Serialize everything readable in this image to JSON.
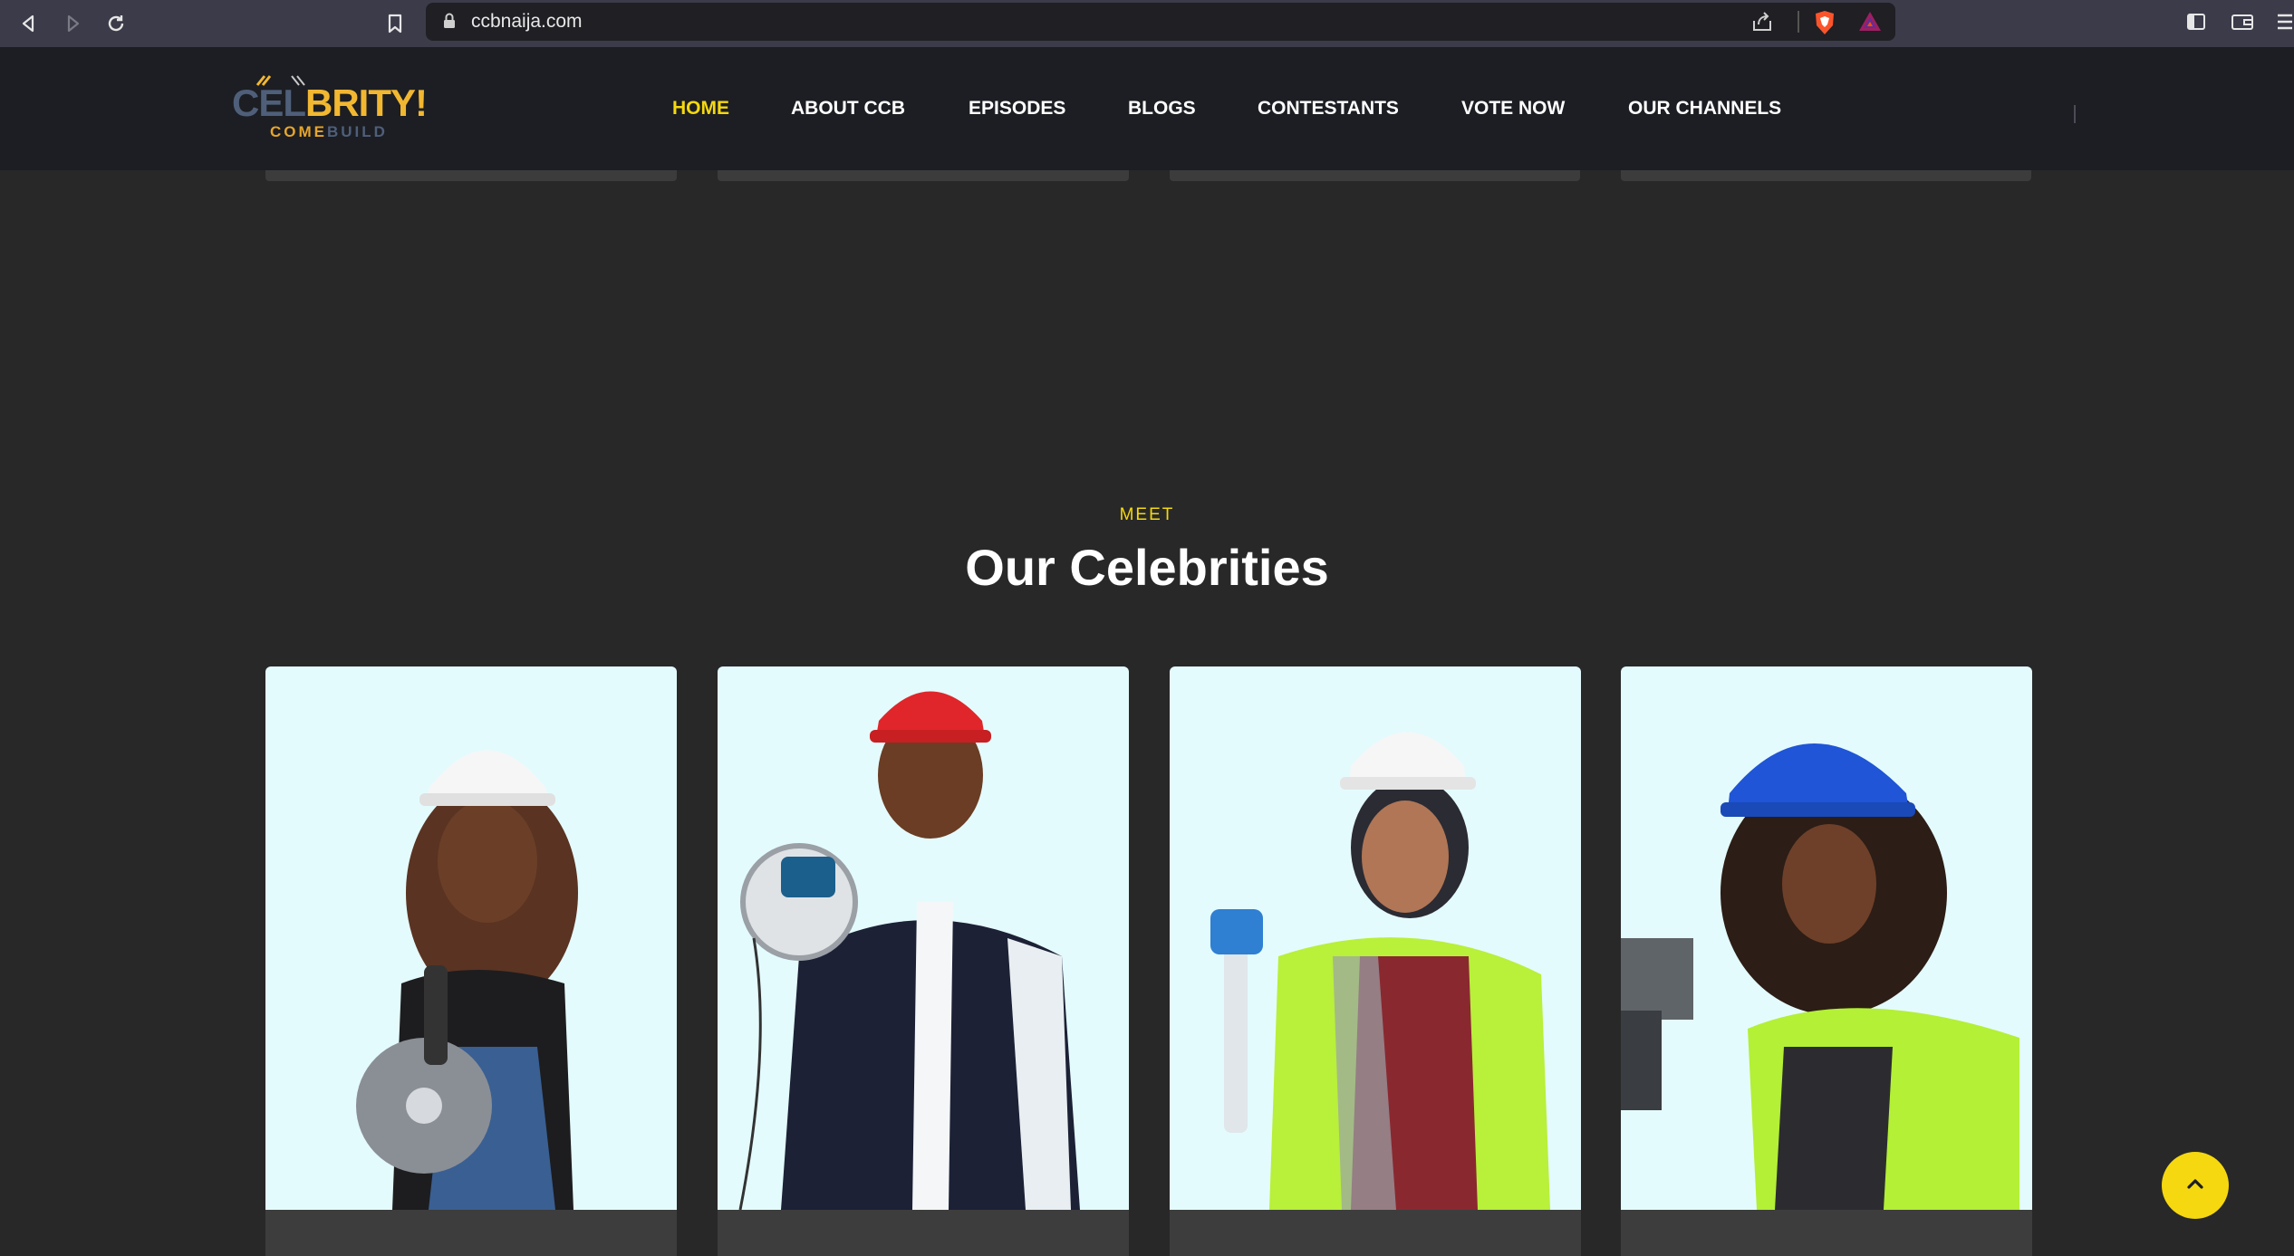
{
  "browser": {
    "url": "ccbnaija.com"
  },
  "logo": {
    "main_part1": "CEL",
    "main_part2": "BRITY!",
    "sub_part1": "COME",
    "sub_part2": "BUILD"
  },
  "nav": {
    "items": [
      {
        "label": "HOME",
        "active": true
      },
      {
        "label": "ABOUT CCB",
        "active": false
      },
      {
        "label": "EPISODES",
        "active": false
      },
      {
        "label": "BLOGS",
        "active": false
      },
      {
        "label": "CONTESTANTS",
        "active": false
      },
      {
        "label": "VOTE NOW",
        "active": false
      },
      {
        "label": "OUR CHANNELS",
        "active": false
      }
    ]
  },
  "section": {
    "eyebrow": "MEET",
    "title": "Our Celebrities"
  },
  "celebrities": [
    {
      "helmet": "white",
      "tool": "angle-grinder"
    },
    {
      "helmet": "red",
      "tool": "circular-saw"
    },
    {
      "helmet": "white",
      "tool": "mallet"
    },
    {
      "helmet": "blue",
      "tool": "drill"
    }
  ],
  "colors": {
    "accent": "#f5d80f",
    "header_bg": "#1c1e23",
    "page_bg": "#282828",
    "photo_bg": "#e4fbfd"
  },
  "icons": [
    "back-icon",
    "forward-icon",
    "reload-icon",
    "bookmark-icon",
    "lock-icon",
    "share-icon",
    "brave-shield-icon",
    "bat-rewards-icon",
    "sidebar-icon",
    "wallet-icon",
    "menu-icon",
    "chevron-up-icon"
  ]
}
